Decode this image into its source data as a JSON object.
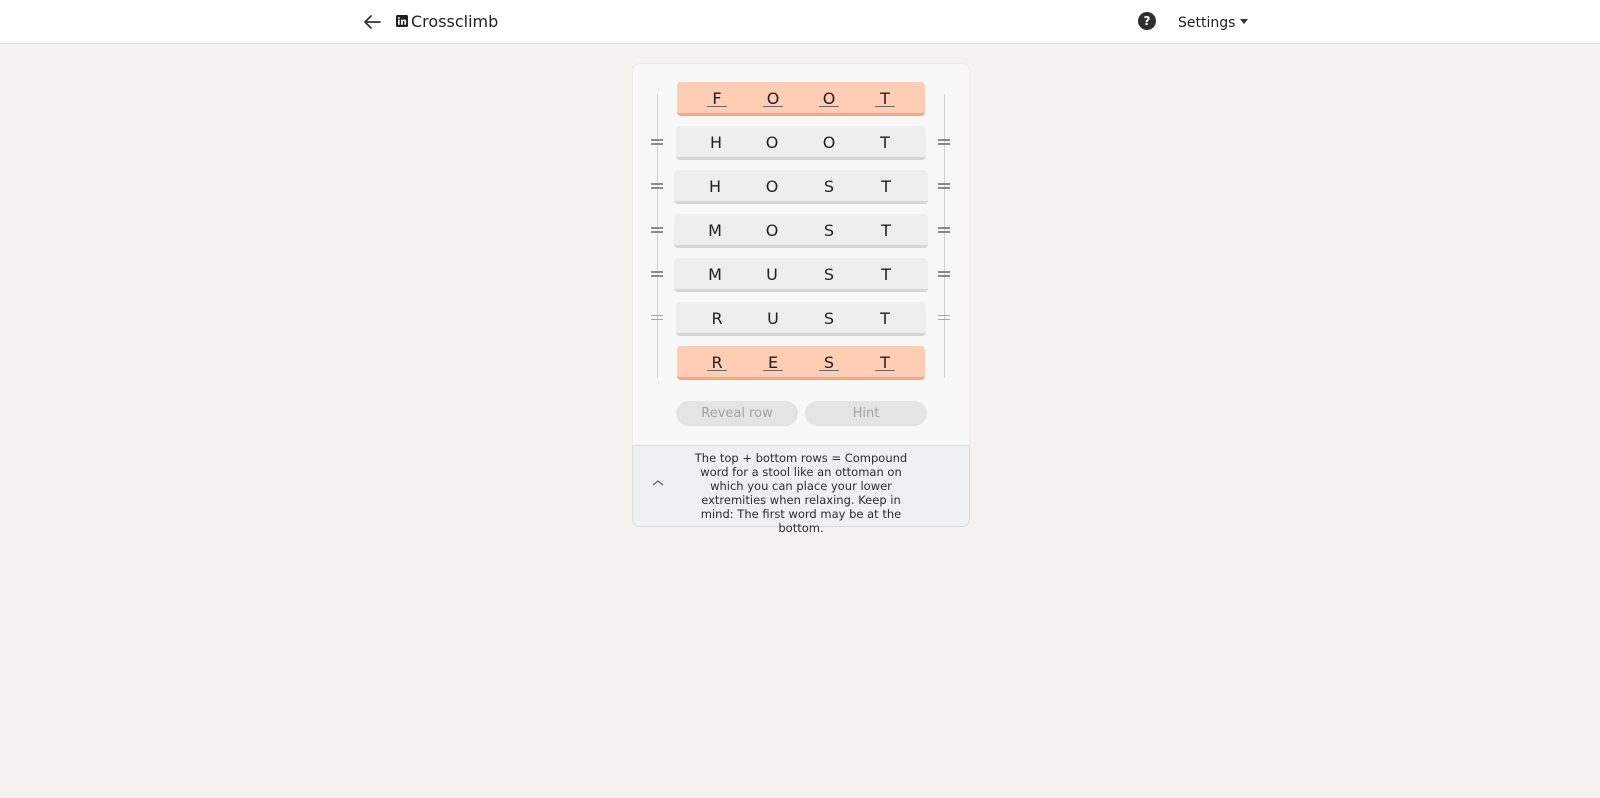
{
  "app": {
    "title": "Crossclimb"
  },
  "header": {
    "settings_label": "Settings",
    "help_glyph": "?"
  },
  "icons": {
    "back": "arrow-left-icon",
    "logo": "linkedin-logo-icon",
    "help": "question-circle-icon",
    "settings_caret": "caret-down-icon",
    "handle": "drag-handle-icon",
    "clue_toggle": "chevron-up-icon"
  },
  "colors": {
    "endpoint_row": "#ffccb4",
    "middle_row": "#eeeeee",
    "background": "#f3f2ef"
  },
  "board": {
    "rows": [
      {
        "letters": [
          "F",
          "O",
          "O",
          "T"
        ],
        "endpoint": true
      },
      {
        "letters": [
          "H",
          "O",
          "O",
          "T"
        ],
        "endpoint": false
      },
      {
        "letters": [
          "H",
          "O",
          "S",
          "T"
        ],
        "endpoint": false
      },
      {
        "letters": [
          "M",
          "O",
          "S",
          "T"
        ],
        "endpoint": false
      },
      {
        "letters": [
          "M",
          "U",
          "S",
          "T"
        ],
        "endpoint": false
      },
      {
        "letters": [
          "R",
          "U",
          "S",
          "T"
        ],
        "endpoint": false
      },
      {
        "letters": [
          "R",
          "E",
          "S",
          "T"
        ],
        "endpoint": true
      }
    ]
  },
  "buttons": {
    "reveal_row": "Reveal row",
    "hint": "Hint"
  },
  "clue": {
    "text": "The top + bottom rows = Compound word for a stool like an ottoman on which you can place your lower extremities when relaxing. Keep in mind: The first word may be at the bottom."
  }
}
